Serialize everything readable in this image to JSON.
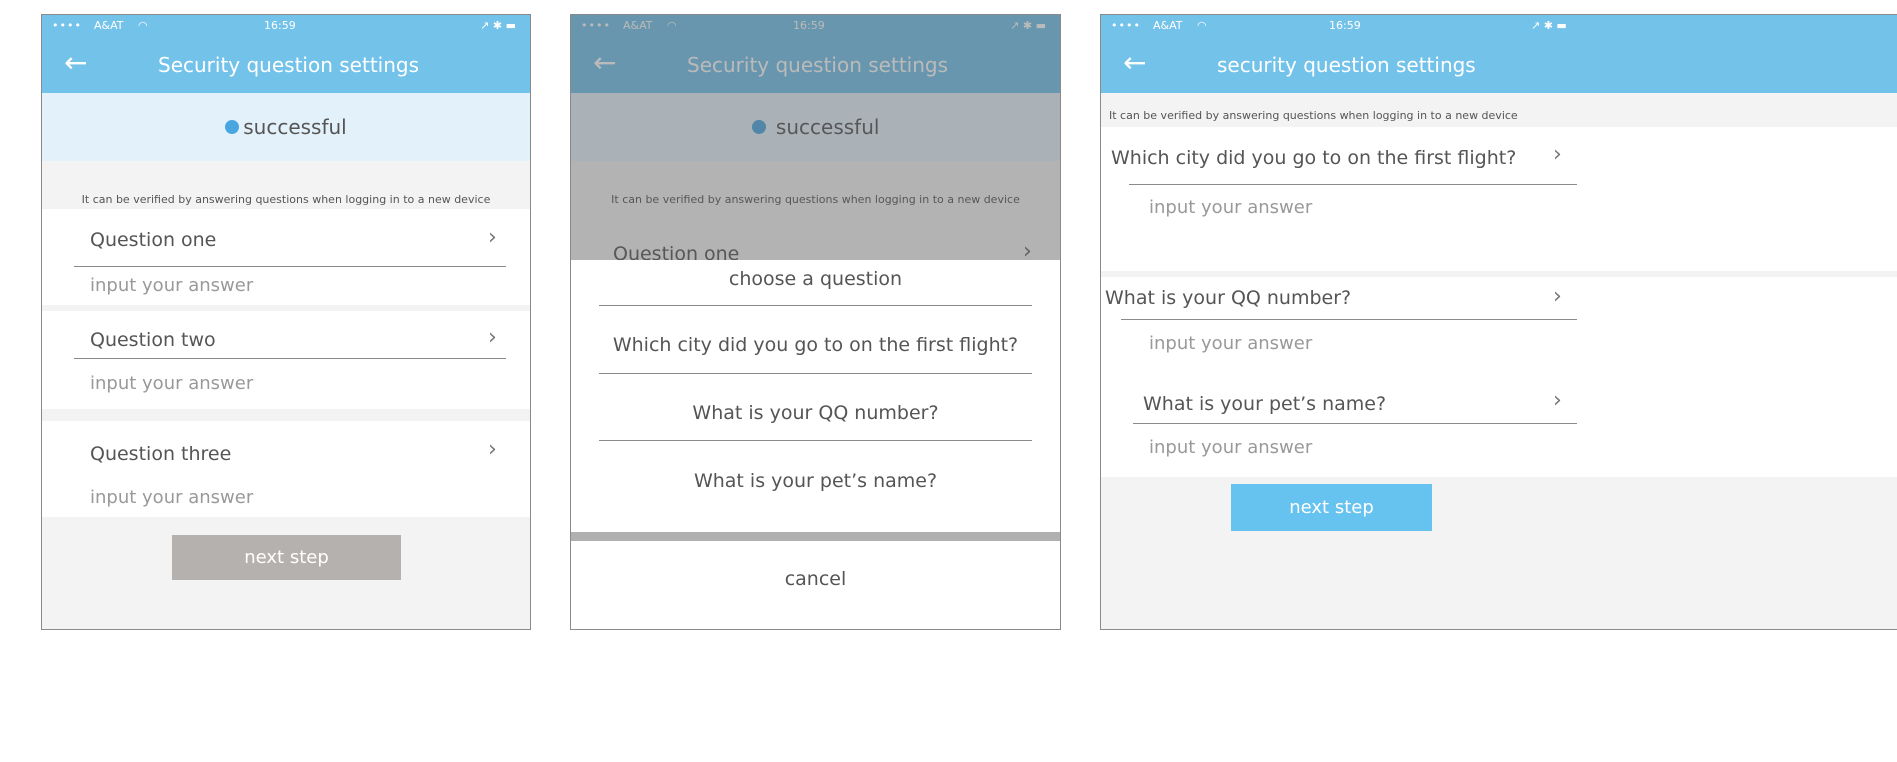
{
  "status_bar": {
    "dots": "••••",
    "carrier": "A&AT",
    "wifi_icon": "◠",
    "time": "16:59",
    "battery": "↗ ✱ ▬"
  },
  "screen1": {
    "title": "Security question settings",
    "success_text": "successful",
    "hint": "It can be verified by answering questions when logging in to a new device",
    "questions": [
      {
        "label": "Question one",
        "placeholder": "input your answer"
      },
      {
        "label": "Question two",
        "placeholder": "input your answer"
      },
      {
        "label": "Question three",
        "placeholder": "input your answer"
      }
    ],
    "next_label": "next step"
  },
  "screen2": {
    "title": "Security question settings",
    "success_text": "successful",
    "hint": "It can be verified by answering questions when logging in to a new device",
    "under_question": "Question one",
    "sheet": {
      "header": "choose a question",
      "options": [
        "Which city did you go to on the first flight?",
        "What is your QQ number?",
        "What is your pet’s name?"
      ],
      "cancel": "cancel"
    }
  },
  "screen3": {
    "title": "security question settings",
    "hint": "It can be verified by answering questions when logging in to a new device",
    "questions": [
      {
        "label": "Which city did you go to on the first flight?",
        "placeholder": "input your answer"
      },
      {
        "label": "What is your QQ number?",
        "placeholder": "input your answer"
      },
      {
        "label": "What is your pet’s name?",
        "placeholder": "input your answer"
      }
    ],
    "next_label": "next step"
  },
  "colors": {
    "primary": "#73c2ea",
    "next_disabled": "#b5b1ae",
    "next_active": "#66c2ee",
    "success_bg": "#e3f1fb"
  }
}
